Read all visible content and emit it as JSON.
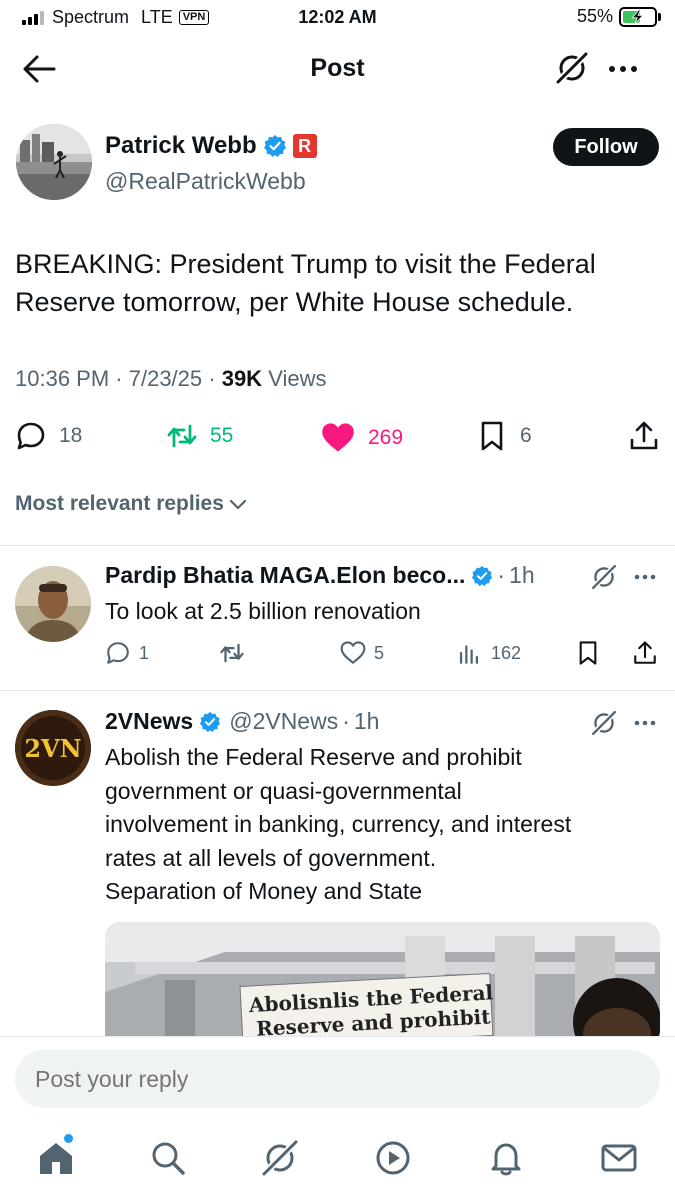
{
  "status_bar": {
    "carrier": "Spectrum",
    "network": "LTE",
    "vpn": "VPN",
    "time": "12:02 AM",
    "battery": "55%",
    "battery_level": 0.55
  },
  "header": {
    "title": "Post"
  },
  "post": {
    "author_name": "Patrick Webb",
    "author_handle": "@RealPatrickWebb",
    "affiliate_badge": "R",
    "follow_label": "Follow",
    "text": "BREAKING: President Trump to visit the Federal Reserve tomorrow, per White House schedule.",
    "time": "10:36 PM",
    "date": "7/23/25",
    "views": "39K",
    "views_label": "Views",
    "replies": "18",
    "reposts": "55",
    "likes": "269",
    "bookmarks": "6",
    "colors": {
      "repost": "#00ba7c",
      "like": "#f91880",
      "verified": "#1d9bf0"
    }
  },
  "sort": {
    "label": "Most relevant replies"
  },
  "replies": [
    {
      "name": "Pardip Bhatia MAGA.Elon beco...",
      "handle": "",
      "time": "1h",
      "text": "To look at 2.5 billion renovation",
      "replies": "1",
      "reposts": "",
      "likes": "5",
      "views": "162"
    },
    {
      "name": "2VNews",
      "handle": "@2VNews",
      "time": "1h",
      "avatar_text": "2VN",
      "text_lines": [
        "Abolish the Federal Reserve and prohibit",
        "government or quasi-governmental",
        "involvement in banking, currency, and interest",
        "rates at all levels of government.",
        "Separation of Money and State"
      ],
      "media_sign_lines": [
        "Abolisnlis the Federal",
        "Reserve and prohibit"
      ]
    }
  ],
  "composer": {
    "placeholder": "Post your reply"
  },
  "tabs": [
    {
      "name": "home-icon"
    },
    {
      "name": "search-icon"
    },
    {
      "name": "grok-icon"
    },
    {
      "name": "video-icon"
    },
    {
      "name": "notifications-icon"
    },
    {
      "name": "messages-icon"
    }
  ]
}
